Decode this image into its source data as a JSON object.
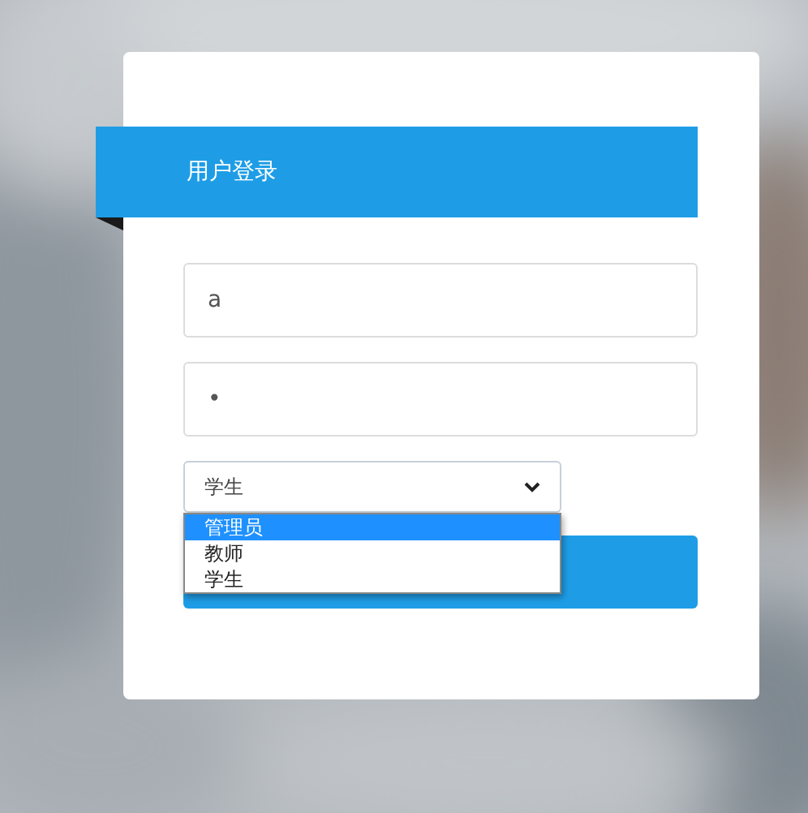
{
  "header": {
    "title": "用户登录"
  },
  "username": {
    "value": "a"
  },
  "password": {
    "value": "•"
  },
  "role_select": {
    "value": "学生",
    "expanded": true,
    "options": [
      {
        "label": "管理员",
        "highlighted": true
      },
      {
        "label": "教师",
        "highlighted": false
      },
      {
        "label": "学生",
        "highlighted": false
      }
    ]
  }
}
